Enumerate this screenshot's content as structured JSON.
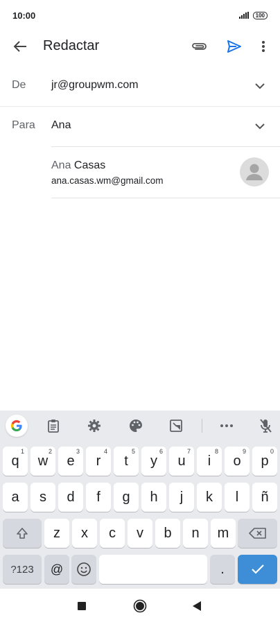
{
  "status": {
    "time": "10:00",
    "battery": "100"
  },
  "app_bar": {
    "title": "Redactar"
  },
  "from": {
    "label": "De",
    "value": "jr@groupwm.com"
  },
  "to": {
    "label": "Para",
    "value": "Ana"
  },
  "suggestion": {
    "name_match": "Ana",
    "name_rest": " Casas",
    "email": "ana.casas.wm@gmail.com"
  },
  "keyboard": {
    "row1": [
      {
        "k": "q",
        "h": "1"
      },
      {
        "k": "w",
        "h": "2"
      },
      {
        "k": "e",
        "h": "3"
      },
      {
        "k": "r",
        "h": "4"
      },
      {
        "k": "t",
        "h": "5"
      },
      {
        "k": "y",
        "h": "6"
      },
      {
        "k": "u",
        "h": "7"
      },
      {
        "k": "i",
        "h": "8"
      },
      {
        "k": "o",
        "h": "9"
      },
      {
        "k": "p",
        "h": "0"
      }
    ],
    "row2": [
      "a",
      "s",
      "d",
      "f",
      "g",
      "h",
      "j",
      "k",
      "l",
      "ñ"
    ],
    "row3": [
      "z",
      "x",
      "c",
      "v",
      "b",
      "n",
      "m"
    ],
    "symbols_label": "?123",
    "at_label": "@",
    "period_label": "."
  },
  "colors": {
    "accent": "#1a73e8",
    "enter_key": "#3d8ed6"
  }
}
